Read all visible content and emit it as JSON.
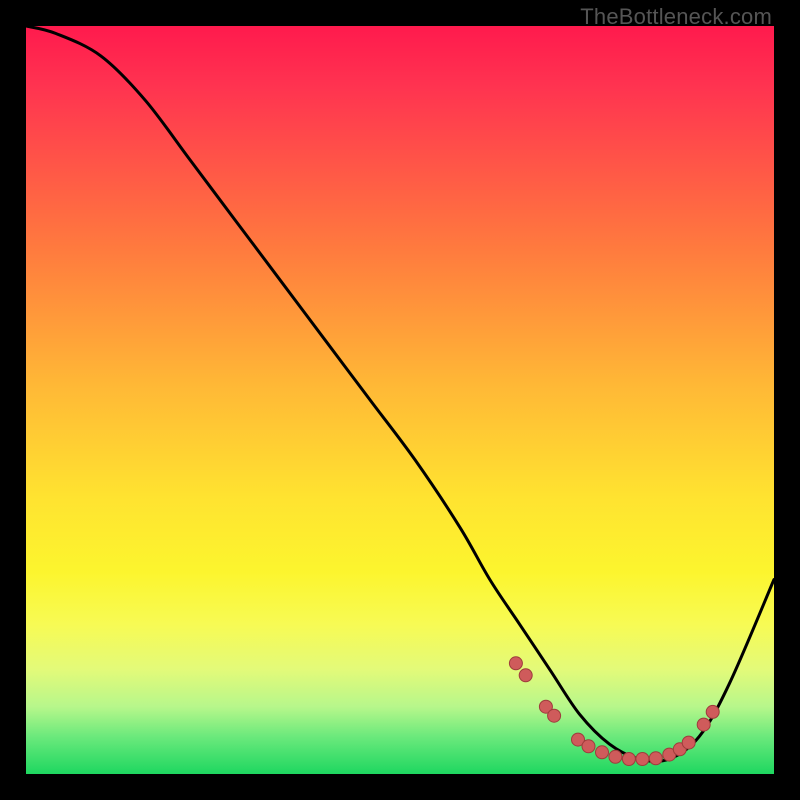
{
  "watermark": "TheBottleneck.com",
  "colors": {
    "frame": "#000000",
    "gradient_top": "#ff1a4d",
    "gradient_mid": "#ffe330",
    "gradient_bottom": "#1ed760",
    "curve": "#000000",
    "marker_fill": "#cf5b5b",
    "marker_stroke": "#9e3c3c"
  },
  "chart_data": {
    "type": "line",
    "title": "",
    "xlabel": "",
    "ylabel": "",
    "xlim": [
      0,
      100
    ],
    "ylim": [
      0,
      100
    ],
    "grid": false,
    "legend": false,
    "series": [
      {
        "name": "bottleneck-curve",
        "x": [
          0,
          4,
          10,
          16,
          22,
          28,
          34,
          40,
          46,
          52,
          58,
          62,
          66,
          70,
          74,
          78,
          82,
          86,
          90,
          94,
          100
        ],
        "values": [
          100,
          99,
          96,
          90,
          82,
          74,
          66,
          58,
          50,
          42,
          33,
          26,
          20,
          14,
          8,
          4,
          2,
          2,
          5,
          12,
          26
        ]
      }
    ],
    "markers": [
      {
        "x": 65.5,
        "y": 14.8
      },
      {
        "x": 66.8,
        "y": 13.2
      },
      {
        "x": 69.5,
        "y": 9.0
      },
      {
        "x": 70.6,
        "y": 7.8
      },
      {
        "x": 73.8,
        "y": 4.6
      },
      {
        "x": 75.2,
        "y": 3.7
      },
      {
        "x": 77.0,
        "y": 2.9
      },
      {
        "x": 78.8,
        "y": 2.3
      },
      {
        "x": 80.6,
        "y": 2.0
      },
      {
        "x": 82.4,
        "y": 2.0
      },
      {
        "x": 84.2,
        "y": 2.1
      },
      {
        "x": 86.0,
        "y": 2.6
      },
      {
        "x": 87.4,
        "y": 3.3
      },
      {
        "x": 88.6,
        "y": 4.2
      },
      {
        "x": 90.6,
        "y": 6.6
      },
      {
        "x": 91.8,
        "y": 8.3
      }
    ]
  }
}
